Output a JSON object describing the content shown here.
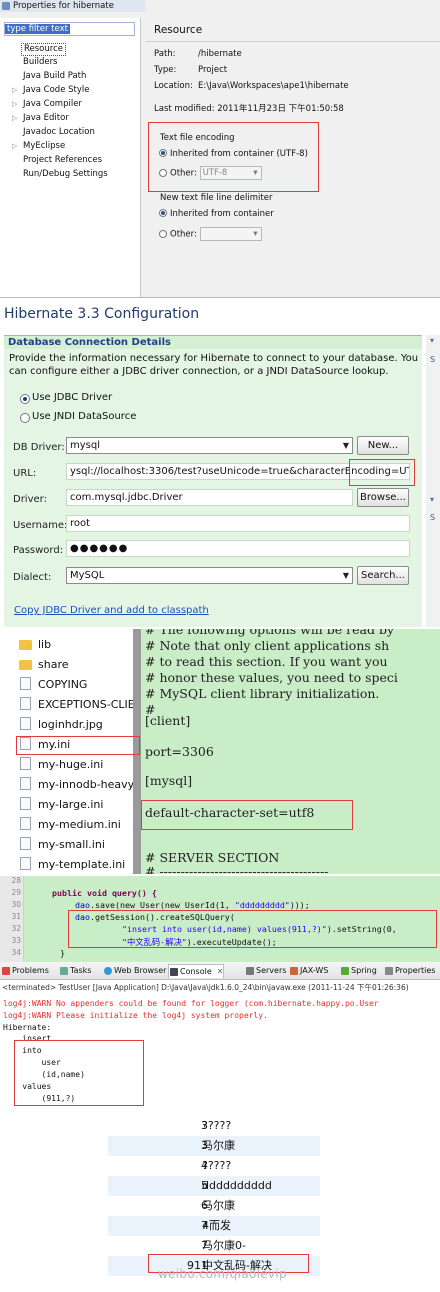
{
  "properties_dialog": {
    "window_title": "Properties for hibernate",
    "filter_placeholder": "type filter text",
    "tree": [
      {
        "label": "Resource",
        "selected": true,
        "expandable": false
      },
      {
        "label": "Builders",
        "expandable": false
      },
      {
        "label": "Java Build Path",
        "expandable": false
      },
      {
        "label": "Java Code Style",
        "expandable": true
      },
      {
        "label": "Java Compiler",
        "expandable": true
      },
      {
        "label": "Java Editor",
        "expandable": true
      },
      {
        "label": "Javadoc Location",
        "expandable": false
      },
      {
        "label": "MyEclipse",
        "expandable": true
      },
      {
        "label": "Project References",
        "expandable": false
      },
      {
        "label": "Run/Debug Settings",
        "expandable": false
      }
    ],
    "section_title": "Resource",
    "path_label": "Path:",
    "path_value": "/hibernate",
    "type_label": "Type:",
    "type_value": "Project",
    "location_label": "Location:",
    "location_value": "E:\\Java\\Workspaces\\ape1\\hibernate",
    "last_modified_label": "Last modified:",
    "last_modified_value": "2011年11月23日 下午01:50:58",
    "encoding_group": "Text file encoding",
    "encoding_inherited": "Inherited from container (UTF-8)",
    "encoding_other_label": "Other:",
    "encoding_other_value": "UTF-8",
    "delimiter_group": "New text file line delimiter",
    "delimiter_inherited": "Inherited from container",
    "delimiter_other_label": "Other:"
  },
  "hibernate_config": {
    "title": "Hibernate 3.3 Configuration",
    "section": "Database Connection Details",
    "description_1": "Provide the information necessary for Hibernate to connect to your database.  You",
    "description_2": "can configure either a JDBC driver connection, or a JNDI DataSource lookup.",
    "radio_jdbc": "Use JDBC Driver",
    "radio_jndi": "Use JNDI DataSource",
    "db_driver_label": "DB Driver:",
    "db_driver_value": "mysql",
    "new_button": "New...",
    "url_label": "URL:",
    "url_value": "ysql://localhost:3306/test?useUnicode=true&characterEncoding=UTF-8",
    "driver_label": "Driver:",
    "driver_value": "com.mysql.jdbc.Driver",
    "browse_button": "Browse...",
    "username_label": "Username:",
    "username_value": "root",
    "password_label": "Password:",
    "password_value": "●●●●●●",
    "dialect_label": "Dialect:",
    "dialect_value": "MySQL",
    "search_button": "Search...",
    "copy_link": "Copy JDBC Driver and add to classpath",
    "side_letters": [
      "S",
      "S"
    ]
  },
  "mysql_files": {
    "files": [
      {
        "name": "lib",
        "kind": "folder"
      },
      {
        "name": "share",
        "kind": "folder"
      },
      {
        "name": "COPYING",
        "kind": "file"
      },
      {
        "name": "EXCEPTIONS-CLIEN",
        "kind": "file"
      },
      {
        "name": "loginhdr.jpg",
        "kind": "file"
      },
      {
        "name": "my.ini",
        "kind": "file"
      },
      {
        "name": "my-huge.ini",
        "kind": "file"
      },
      {
        "name": "my-innodb-heavy-",
        "kind": "file"
      },
      {
        "name": "my-large.ini",
        "kind": "file"
      },
      {
        "name": "my-medium.ini",
        "kind": "file"
      },
      {
        "name": "my-small.ini",
        "kind": "file"
      },
      {
        "name": "my-template.ini",
        "kind": "file"
      }
    ],
    "config_lines": [
      "# The following options will be read by",
      "# Note that only client applications sh",
      "# to read this section. If you want you",
      "# honor these values, you need to speci",
      "# MySQL client library initialization.",
      "#",
      "[client]",
      "",
      "port=3306",
      "",
      "[mysql]",
      "",
      "default-character-set=utf8",
      "",
      "",
      "# SERVER SECTION",
      "# ----------------------------------------"
    ]
  },
  "java_code": {
    "line_numbers": [
      "28",
      "29",
      "30",
      "31",
      "32",
      "33",
      "34"
    ],
    "line29": "public void query() {",
    "line30_a": "dao",
    "line30_b": ".save(new User(new UserId(1, ",
    "line30_c": "\"ddddddddd\"",
    "line30_d": ")));",
    "line31_a": "dao",
    "line31_b": ".getSession().createSQLQuery(",
    "line32_a": "\"insert into user(id,name) values(911,?)\"",
    "line32_b": ").setString(0,",
    "line33_a": "\"中文乱码-解决\"",
    "line33_b": ").executeUpdate();",
    "line34": "}"
  },
  "console": {
    "tabs": [
      "Problems",
      "Tasks",
      "Web Browser",
      "Console",
      "Servers",
      "JAX-WS",
      "Spring",
      "Properties"
    ],
    "terminated": "<terminated> TestUser [Java Application] D:\\Java\\Java\\jdk1.6.0_24\\bin\\javaw.exe (2011-11-24 下午01:26:36)",
    "lines": [
      {
        "text": "log4j:WARN No appenders could be found for logger (com.hibernate.happy.po.User",
        "err": true
      },
      {
        "text": "log4j:WARN Please initialize the log4j system properly.",
        "err": true
      },
      {
        "text": "Hibernate:",
        "err": false
      },
      {
        "text": "    insert",
        "err": false
      },
      {
        "text": "    into",
        "err": false
      },
      {
        "text": "        user",
        "err": false
      },
      {
        "text": "        (id,name)",
        "err": false
      },
      {
        "text": "    values",
        "err": false
      },
      {
        "text": "        (911,?)",
        "err": false
      }
    ]
  },
  "db_rows": [
    {
      "id": "3",
      "name": "?????"
    },
    {
      "id": "3",
      "name": "马尔康"
    },
    {
      "id": "4",
      "name": "?????"
    },
    {
      "id": "5",
      "name": "dddddddddd"
    },
    {
      "id": "6",
      "name": "马尔康"
    },
    {
      "id": "7",
      "name": "4而发"
    },
    {
      "id": "7",
      "name": "马尔康0-"
    },
    {
      "id": "911",
      "name": "中文乱码-解决"
    }
  ],
  "watermark": "weibo.com/qiaolevip",
  "colors": {
    "highlight": "#e23b3b",
    "editor_bg": "#c9edc6",
    "link": "#1a4fbf",
    "title_blue": "#1f3c6a"
  }
}
